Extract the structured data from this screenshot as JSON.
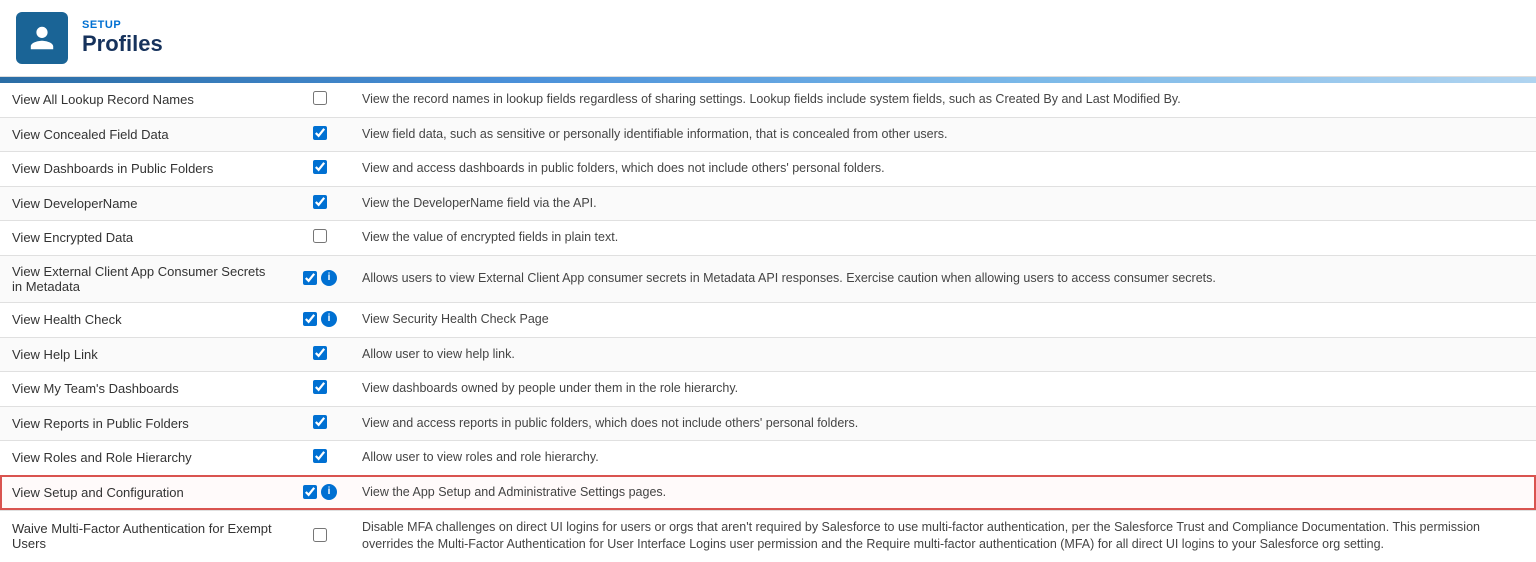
{
  "header": {
    "setup_label": "SETUP",
    "page_title": "Profiles"
  },
  "rows": [
    {
      "name": "View All Lookup Record Names",
      "checked": false,
      "has_info": false,
      "description": "View the record names in lookup fields regardless of sharing settings. Lookup fields include system fields, such as Created By and Last Modified By.",
      "highlighted": false
    },
    {
      "name": "View Concealed Field Data",
      "checked": true,
      "has_info": false,
      "description": "View field data, such as sensitive or personally identifiable information, that is concealed from other users.",
      "highlighted": false
    },
    {
      "name": "View Dashboards in Public Folders",
      "checked": true,
      "has_info": false,
      "description": "View and access dashboards in public folders, which does not include others' personal folders.",
      "highlighted": false
    },
    {
      "name": "View DeveloperName",
      "checked": true,
      "has_info": false,
      "description": "View the DeveloperName field via the API.",
      "highlighted": false
    },
    {
      "name": "View Encrypted Data",
      "checked": false,
      "has_info": false,
      "description": "View the value of encrypted fields in plain text.",
      "highlighted": false
    },
    {
      "name": "View External Client App Consumer Secrets in Metadata",
      "checked": true,
      "has_info": true,
      "description": "Allows users to view External Client App consumer secrets in Metadata API responses. Exercise caution when allowing users to access consumer secrets.",
      "highlighted": false
    },
    {
      "name": "View Health Check",
      "checked": true,
      "has_info": true,
      "description": "View Security Health Check Page",
      "highlighted": false
    },
    {
      "name": "View Help Link",
      "checked": true,
      "has_info": false,
      "description": "Allow user to view help link.",
      "highlighted": false
    },
    {
      "name": "View My Team's Dashboards",
      "checked": true,
      "has_info": false,
      "description": "View dashboards owned by people under them in the role hierarchy.",
      "highlighted": false
    },
    {
      "name": "View Reports in Public Folders",
      "checked": true,
      "has_info": false,
      "description": "View and access reports in public folders, which does not include others' personal folders.",
      "highlighted": false
    },
    {
      "name": "View Roles and Role Hierarchy",
      "checked": true,
      "has_info": false,
      "description": "Allow user to view roles and role hierarchy.",
      "highlighted": false
    },
    {
      "name": "View Setup and Configuration",
      "checked": true,
      "has_info": true,
      "description": "View the App Setup and Administrative Settings pages.",
      "highlighted": true
    },
    {
      "name": "Waive Multi-Factor Authentication for Exempt Users",
      "checked": false,
      "has_info": false,
      "description": "Disable MFA challenges on direct UI logins for users or orgs that aren't required by Salesforce to use multi-factor authentication, per the Salesforce Trust and Compliance Documentation. This permission overrides the Multi-Factor Authentication for User Interface Logins user permission and the Require multi-factor authentication (MFA) for all direct UI logins to your Salesforce org setting.",
      "highlighted": false
    }
  ],
  "icons": {
    "info": "i",
    "user": "👤"
  }
}
